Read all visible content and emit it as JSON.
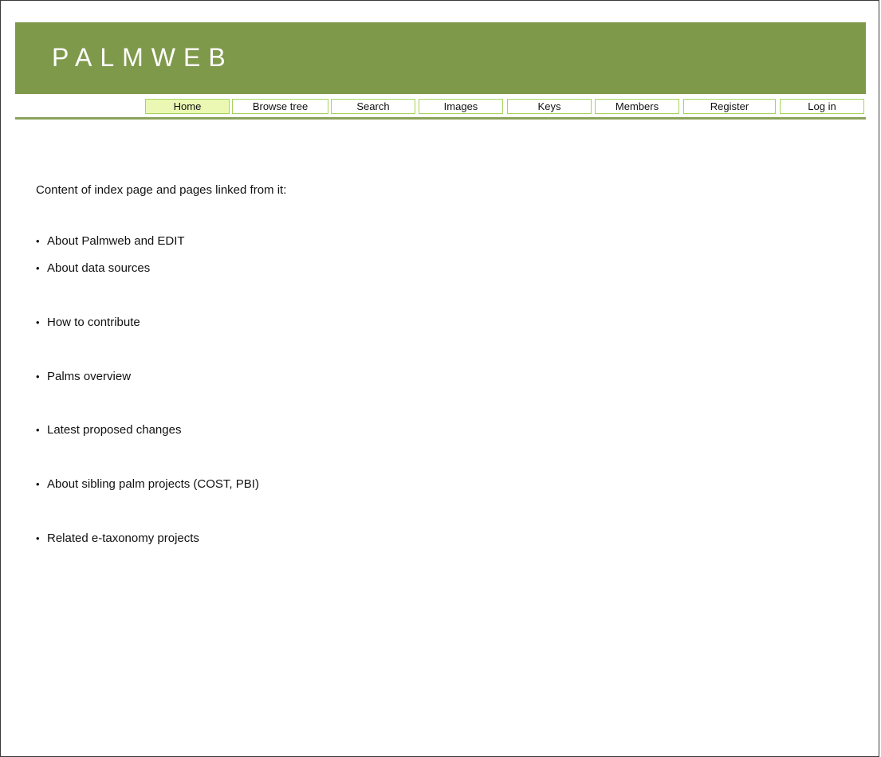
{
  "site": {
    "title": "PALMWEB"
  },
  "nav": {
    "items": [
      {
        "label": "Home",
        "active": true
      },
      {
        "label": "Browse tree"
      },
      {
        "label": "Search"
      },
      {
        "label": "Images"
      },
      {
        "label": "Keys"
      },
      {
        "label": "Members"
      },
      {
        "label": "Register"
      },
      {
        "label": "Log in"
      }
    ]
  },
  "content": {
    "intro": "Content of index page and pages linked from it:",
    "bullet": "•",
    "links": [
      "About Palmweb and EDIT",
      "About data sources",
      "How to contribute",
      "Palms overview",
      "Latest proposed changes",
      "About sibling palm projects (COST, PBI)",
      "Related e-taxonomy projects"
    ]
  },
  "colors": {
    "banner": "#7f994b",
    "nav_border": "#a6d45a",
    "nav_active_bg": "#eaf8b4",
    "rule": "#8aa35a"
  }
}
